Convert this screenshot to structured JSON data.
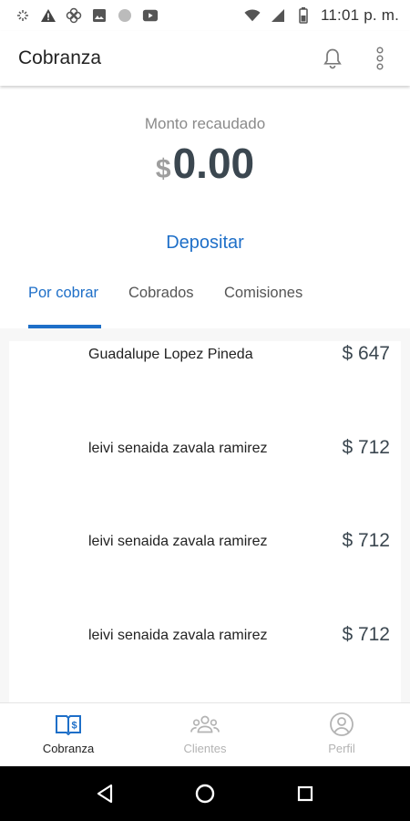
{
  "status_bar": {
    "time": "11:01 p. m.",
    "left_icons": [
      "sync-icon",
      "warning-icon",
      "pinwheel-icon",
      "image-icon",
      "circle-icon",
      "youtube-icon"
    ],
    "right_icons": [
      "wifi-icon",
      "signal-icon",
      "battery-icon"
    ]
  },
  "app_bar": {
    "title": "Cobranza",
    "actions": [
      "bell-icon",
      "more-vert-icon"
    ]
  },
  "summary": {
    "label": "Monto recaudado",
    "currency": "$",
    "amount": "0.00",
    "deposit_label": "Depositar"
  },
  "tabs": [
    {
      "label": "Por cobrar",
      "active": true
    },
    {
      "label": "Cobrados",
      "active": false
    },
    {
      "label": "Comisiones",
      "active": false
    }
  ],
  "items": [
    {
      "name": "Guadalupe Lopez Pineda",
      "amount": "$ 647"
    },
    {
      "name": "leivi senaida zavala ramirez",
      "amount": "$ 712"
    },
    {
      "name": "leivi senaida zavala ramirez",
      "amount": "$ 712"
    },
    {
      "name": "leivi senaida zavala ramirez",
      "amount": "$ 712"
    }
  ],
  "bottom_nav": [
    {
      "label": "Cobranza",
      "icon": "cobranza-icon",
      "active": true
    },
    {
      "label": "Clientes",
      "icon": "clients-icon",
      "active": false
    },
    {
      "label": "Perfil",
      "icon": "profile-icon",
      "active": false
    }
  ],
  "colors": {
    "accent": "#1e6fc8",
    "amount_text": "#3b4750",
    "inactive": "#b3b3b3"
  },
  "system_nav": [
    "back-icon",
    "home-icon",
    "recents-icon"
  ]
}
